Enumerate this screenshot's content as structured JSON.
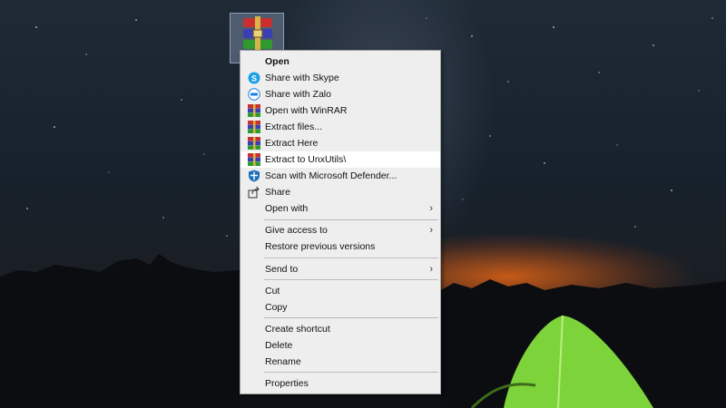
{
  "desktop": {
    "icon_name": "winrar-archive-icon"
  },
  "context_menu": {
    "items": [
      {
        "label": "Open",
        "icon": "none"
      },
      {
        "label": "Share with Skype",
        "icon": "skype-icon"
      },
      {
        "label": "Share with Zalo",
        "icon": "zalo-icon"
      },
      {
        "label": "Open with WinRAR",
        "icon": "winrar-icon"
      },
      {
        "label": "Extract files...",
        "icon": "winrar-icon"
      },
      {
        "label": "Extract Here",
        "icon": "winrar-icon"
      },
      {
        "label": "Extract to UnxUtils\\",
        "icon": "winrar-icon"
      },
      {
        "label": "Scan with Microsoft Defender...",
        "icon": "defender-shield-icon"
      },
      {
        "label": "Share",
        "icon": "share-icon"
      },
      {
        "label": "Open with",
        "icon": "none"
      },
      {
        "label": "Give access to",
        "icon": "none"
      },
      {
        "label": "Restore previous versions",
        "icon": "none"
      },
      {
        "label": "Send to",
        "icon": "none"
      },
      {
        "label": "Cut",
        "icon": "none"
      },
      {
        "label": "Copy",
        "icon": "none"
      },
      {
        "label": "Create shortcut",
        "icon": "none"
      },
      {
        "label": "Delete",
        "icon": "none"
      },
      {
        "label": "Rename",
        "icon": "none"
      },
      {
        "label": "Properties",
        "icon": "none"
      }
    ],
    "highlighted_item": "Extract to UnxUtils\\",
    "submenu_arrow": "›"
  },
  "colors": {
    "menu_background": "#eeeeee",
    "highlight": "#ffffff",
    "separator": "#bcbcbc",
    "skype_blue": "#1aa0e6",
    "tent_green": "#7cd33a"
  }
}
